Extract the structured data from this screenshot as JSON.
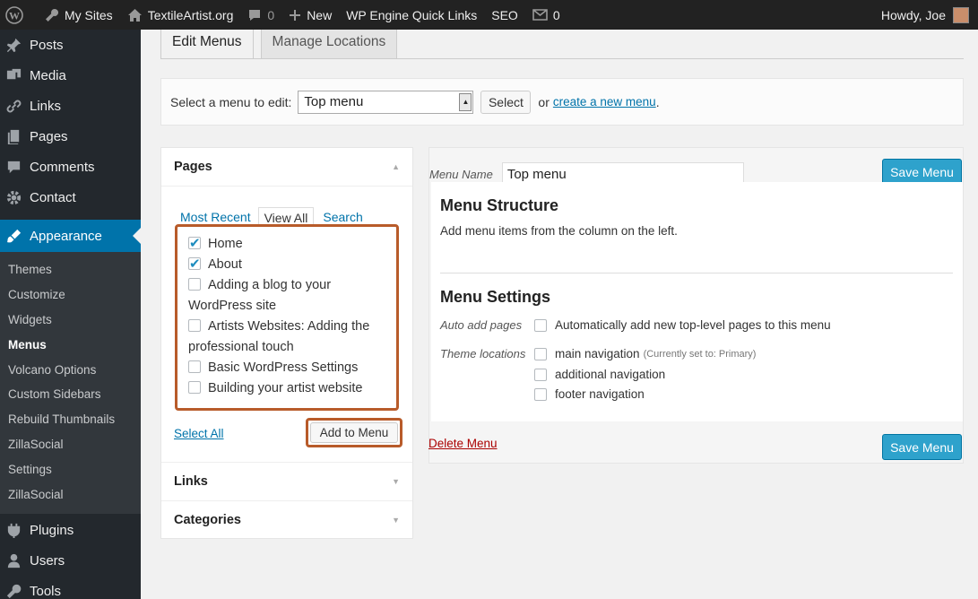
{
  "adminbar": {
    "my_sites": "My Sites",
    "site_name": "TextileArtist.org",
    "comments_count": "0",
    "new_label": "New",
    "quick_links": "WP Engine Quick Links",
    "seo": "SEO",
    "messages_count": "0",
    "greeting": "Howdy, Joe"
  },
  "sidebar": {
    "top_items": [
      {
        "label": "Posts",
        "icon": "pin-icon"
      },
      {
        "label": "Media",
        "icon": "media-icon"
      },
      {
        "label": "Links",
        "icon": "link-icon"
      },
      {
        "label": "Pages",
        "icon": "pages-icon"
      },
      {
        "label": "Comments",
        "icon": "comment-icon"
      },
      {
        "label": "Contact",
        "icon": "gear-icon"
      }
    ],
    "active_item": "Appearance",
    "submenu": [
      "Themes",
      "Customize",
      "Widgets",
      "Menus",
      "Volcano Options",
      "Custom Sidebars",
      "Rebuild Thumbnails",
      "ZillaSocial",
      "Settings",
      "ZillaSocial"
    ],
    "current_submenu": "Menus",
    "bottom_items": [
      "Plugins",
      "Users",
      "Tools"
    ]
  },
  "tabs": {
    "edit_menus": "Edit Menus",
    "manage_locations": "Manage Locations"
  },
  "select_bar": {
    "label": "Select a menu to edit:",
    "selected": "Top menu",
    "select_button": "Select",
    "or_text": "or",
    "create_link": "create a new menu",
    "period": "."
  },
  "pages_box": {
    "title": "Pages",
    "subtabs": [
      "Most Recent",
      "View All",
      "Search"
    ],
    "items": [
      {
        "label": "Home",
        "checked": true
      },
      {
        "label": "About",
        "checked": true
      },
      {
        "label": "Adding a blog to your WordPress site",
        "checked": false
      },
      {
        "label": "Artists Websites: Adding the professional touch",
        "checked": false
      },
      {
        "label": "Basic WordPress Settings",
        "checked": false
      },
      {
        "label": "Building your artist website",
        "checked": false
      }
    ],
    "select_all": "Select All",
    "add_button": "Add to Menu",
    "links_title": "Links",
    "categories_title": "Categories"
  },
  "menu_editor": {
    "name_label": "Menu Name",
    "name_value": "Top menu",
    "save_button": "Save Menu",
    "structure_title": "Menu Structure",
    "structure_note": "Add menu items from the column on the left.",
    "settings_title": "Menu Settings",
    "auto_add_label": "Auto add pages",
    "auto_add_option": "Automatically add new top-level pages to this menu",
    "theme_locations_label": "Theme locations",
    "locations": [
      {
        "label": "main navigation",
        "note": "(Currently set to: Primary)"
      },
      {
        "label": "additional navigation",
        "note": ""
      },
      {
        "label": "footer navigation",
        "note": ""
      }
    ],
    "delete_link": "Delete Menu"
  },
  "colors": {
    "admin_bar": "#222222",
    "sidebar": "#23282d",
    "active": "#0073aa",
    "primary_button": "#2ea2cc",
    "highlight_border": "#b85b2a",
    "delete": "#aa0000"
  }
}
